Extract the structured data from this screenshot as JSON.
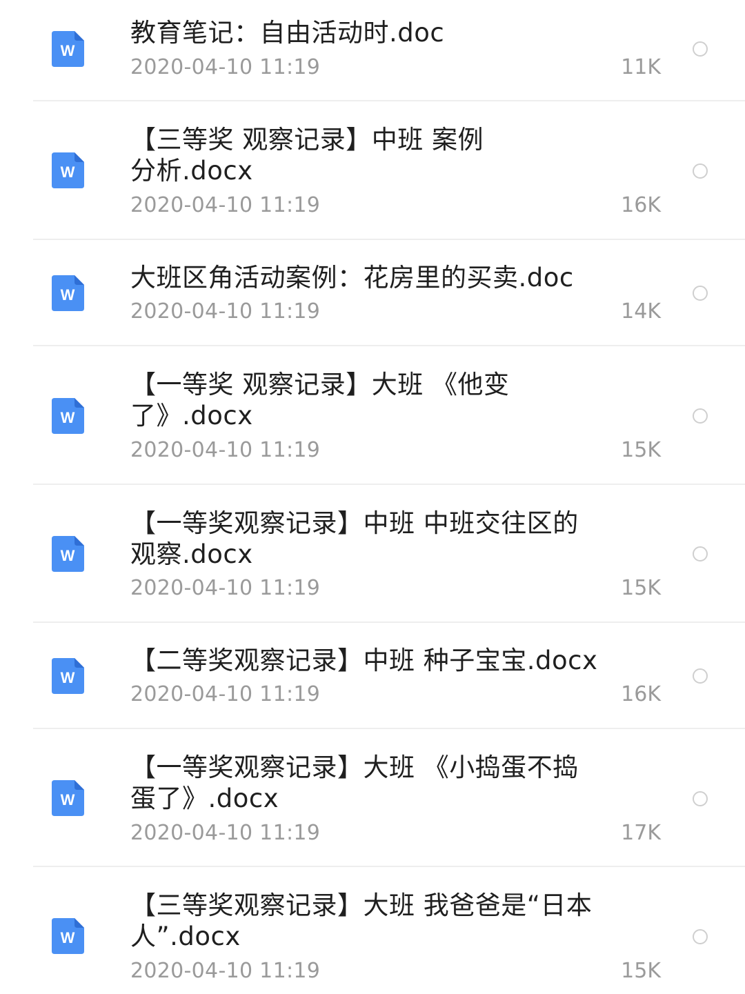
{
  "files": [
    {
      "name": "教育笔记：自由活动时.doc",
      "time": "2020-04-10 11:19",
      "size": "11K",
      "icon": "word-doc-icon"
    },
    {
      "name": "【三等奖 观察记录】中班 案例\n分析.docx",
      "time": "2020-04-10 11:19",
      "size": "16K",
      "icon": "word-doc-icon"
    },
    {
      "name": "大班区角活动案例：花房里的买卖.doc",
      "time": "2020-04-10 11:19",
      "size": "14K",
      "icon": "word-doc-icon"
    },
    {
      "name": "【一等奖 观察记录】大班 《他变\n了》.docx",
      "time": "2020-04-10 11:19",
      "size": "15K",
      "icon": "word-doc-icon"
    },
    {
      "name": "【一等奖观察记录】中班 中班交往区的\n观察.docx",
      "time": "2020-04-10 11:19",
      "size": "15K",
      "icon": "word-doc-icon"
    },
    {
      "name": "【二等奖观察记录】中班 种子宝宝.docx",
      "time": "2020-04-10 11:19",
      "size": "16K",
      "icon": "word-doc-icon"
    },
    {
      "name": "【一等奖观察记录】大班 《小捣蛋不捣\n蛋了》.docx",
      "time": "2020-04-10 11:19",
      "size": "17K",
      "icon": "word-doc-icon"
    },
    {
      "name": "【三等奖观察记录】大班 我爸爸是“日本\n人”.docx",
      "time": "2020-04-10 11:19",
      "size": "15K",
      "icon": "word-doc-icon"
    }
  ],
  "icon_letter": "W",
  "colors": {
    "icon_blue": "#4a90f4",
    "title_text": "#1f1f1f",
    "meta_text": "#9a9a9a",
    "divider": "#eeeeee",
    "radio_border": "#cfcfcf"
  }
}
